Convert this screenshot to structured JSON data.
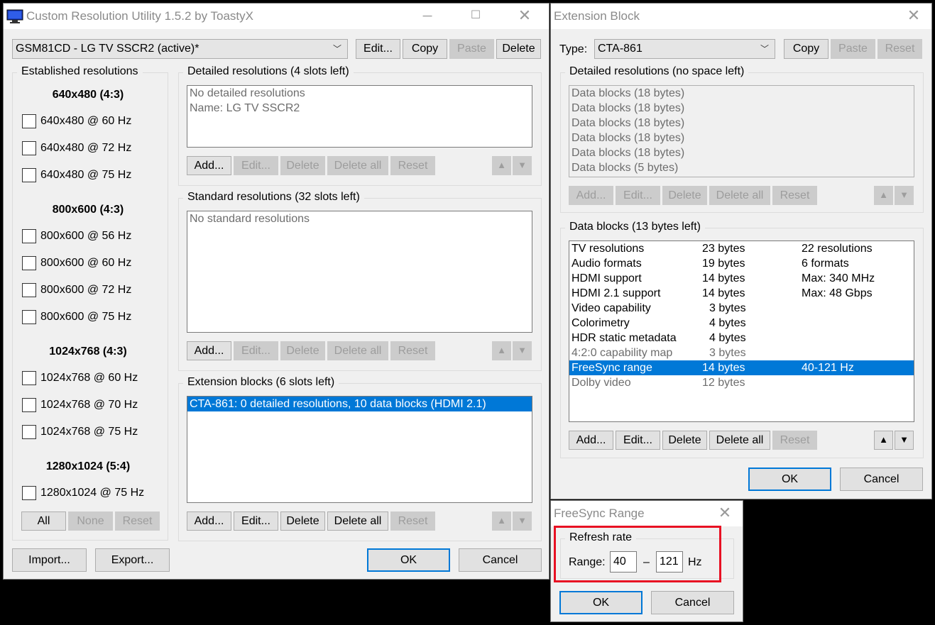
{
  "main": {
    "title": "Custom Resolution Utility 1.5.2 by ToastyX",
    "monitor": "GSM81CD - LG TV SSCR2 (active)*",
    "top_buttons": [
      "Edit...",
      "Copy",
      "Paste",
      "Delete"
    ],
    "established": {
      "label": "Established resolutions",
      "groups": [
        {
          "heading": "640x480 (4:3)",
          "items": [
            "640x480 @ 60 Hz",
            "640x480 @ 72 Hz",
            "640x480 @ 75 Hz"
          ]
        },
        {
          "heading": "800x600 (4:3)",
          "items": [
            "800x600 @ 56 Hz",
            "800x600 @ 60 Hz",
            "800x600 @ 72 Hz",
            "800x600 @ 75 Hz"
          ]
        },
        {
          "heading": "1024x768 (4:3)",
          "items": [
            "1024x768 @ 60 Hz",
            "1024x768 @ 70 Hz",
            "1024x768 @ 75 Hz"
          ]
        },
        {
          "heading": "1280x1024 (5:4)",
          "items": [
            "1280x1024 @ 75 Hz"
          ]
        }
      ],
      "buttons": [
        "All",
        "None",
        "Reset"
      ]
    },
    "detailed": {
      "label": "Detailed resolutions (4 slots left)",
      "lines": [
        "No detailed resolutions",
        "Name: LG TV SSCR2"
      ]
    },
    "standard": {
      "label": "Standard resolutions (32 slots left)",
      "lines": [
        "No standard resolutions"
      ]
    },
    "extension": {
      "label": "Extension blocks (6 slots left)",
      "lines": [
        "CTA-861: 0 detailed resolutions, 10 data blocks (HDMI 2.1)"
      ]
    },
    "list_buttons": [
      "Add...",
      "Edit...",
      "Delete",
      "Delete all",
      "Reset"
    ],
    "import": "Import...",
    "export": "Export...",
    "ok": "OK",
    "cancel": "Cancel"
  },
  "ext": {
    "title": "Extension Block",
    "type_label": "Type:",
    "type_value": "CTA-861",
    "top_buttons": [
      "Copy",
      "Paste",
      "Reset"
    ],
    "detailed": {
      "label": "Detailed resolutions (no space left)",
      "lines": [
        "Data blocks (18 bytes)",
        "Data blocks (18 bytes)",
        "Data blocks (18 bytes)",
        "Data blocks (18 bytes)",
        "Data blocks (18 bytes)",
        "Data blocks (5 bytes)"
      ]
    },
    "data_blocks": {
      "label": "Data blocks (13 bytes left)",
      "rows": [
        {
          "name": "TV resolutions",
          "size": "23 bytes",
          "info": "22 resolutions"
        },
        {
          "name": "Audio formats",
          "size": "19 bytes",
          "info": "6 formats"
        },
        {
          "name": "HDMI support",
          "size": "14 bytes",
          "info": "Max: 340 MHz"
        },
        {
          "name": "HDMI 2.1 support",
          "size": "14 bytes",
          "info": "Max: 48 Gbps"
        },
        {
          "name": "Video capability",
          "size": "3 bytes",
          "info": ""
        },
        {
          "name": "Colorimetry",
          "size": "4 bytes",
          "info": ""
        },
        {
          "name": "HDR static metadata",
          "size": "4 bytes",
          "info": ""
        },
        {
          "name": "4:2:0 capability map",
          "size": "3 bytes",
          "info": ""
        },
        {
          "name": "FreeSync range",
          "size": "14 bytes",
          "info": "40-121 Hz"
        },
        {
          "name": "Dolby video",
          "size": "12 bytes",
          "info": ""
        }
      ]
    },
    "list_buttons": [
      "Add...",
      "Edit...",
      "Delete",
      "Delete all",
      "Reset"
    ],
    "ok": "OK",
    "cancel": "Cancel"
  },
  "freesync": {
    "title": "FreeSync Range",
    "group_label": "Refresh rate",
    "range_label": "Range:",
    "min": "40",
    "dash": "–",
    "max": "121",
    "unit": "Hz",
    "ok": "OK",
    "cancel": "Cancel"
  },
  "colors": {
    "accent": "#0078d7",
    "highlight": "#e81123"
  }
}
